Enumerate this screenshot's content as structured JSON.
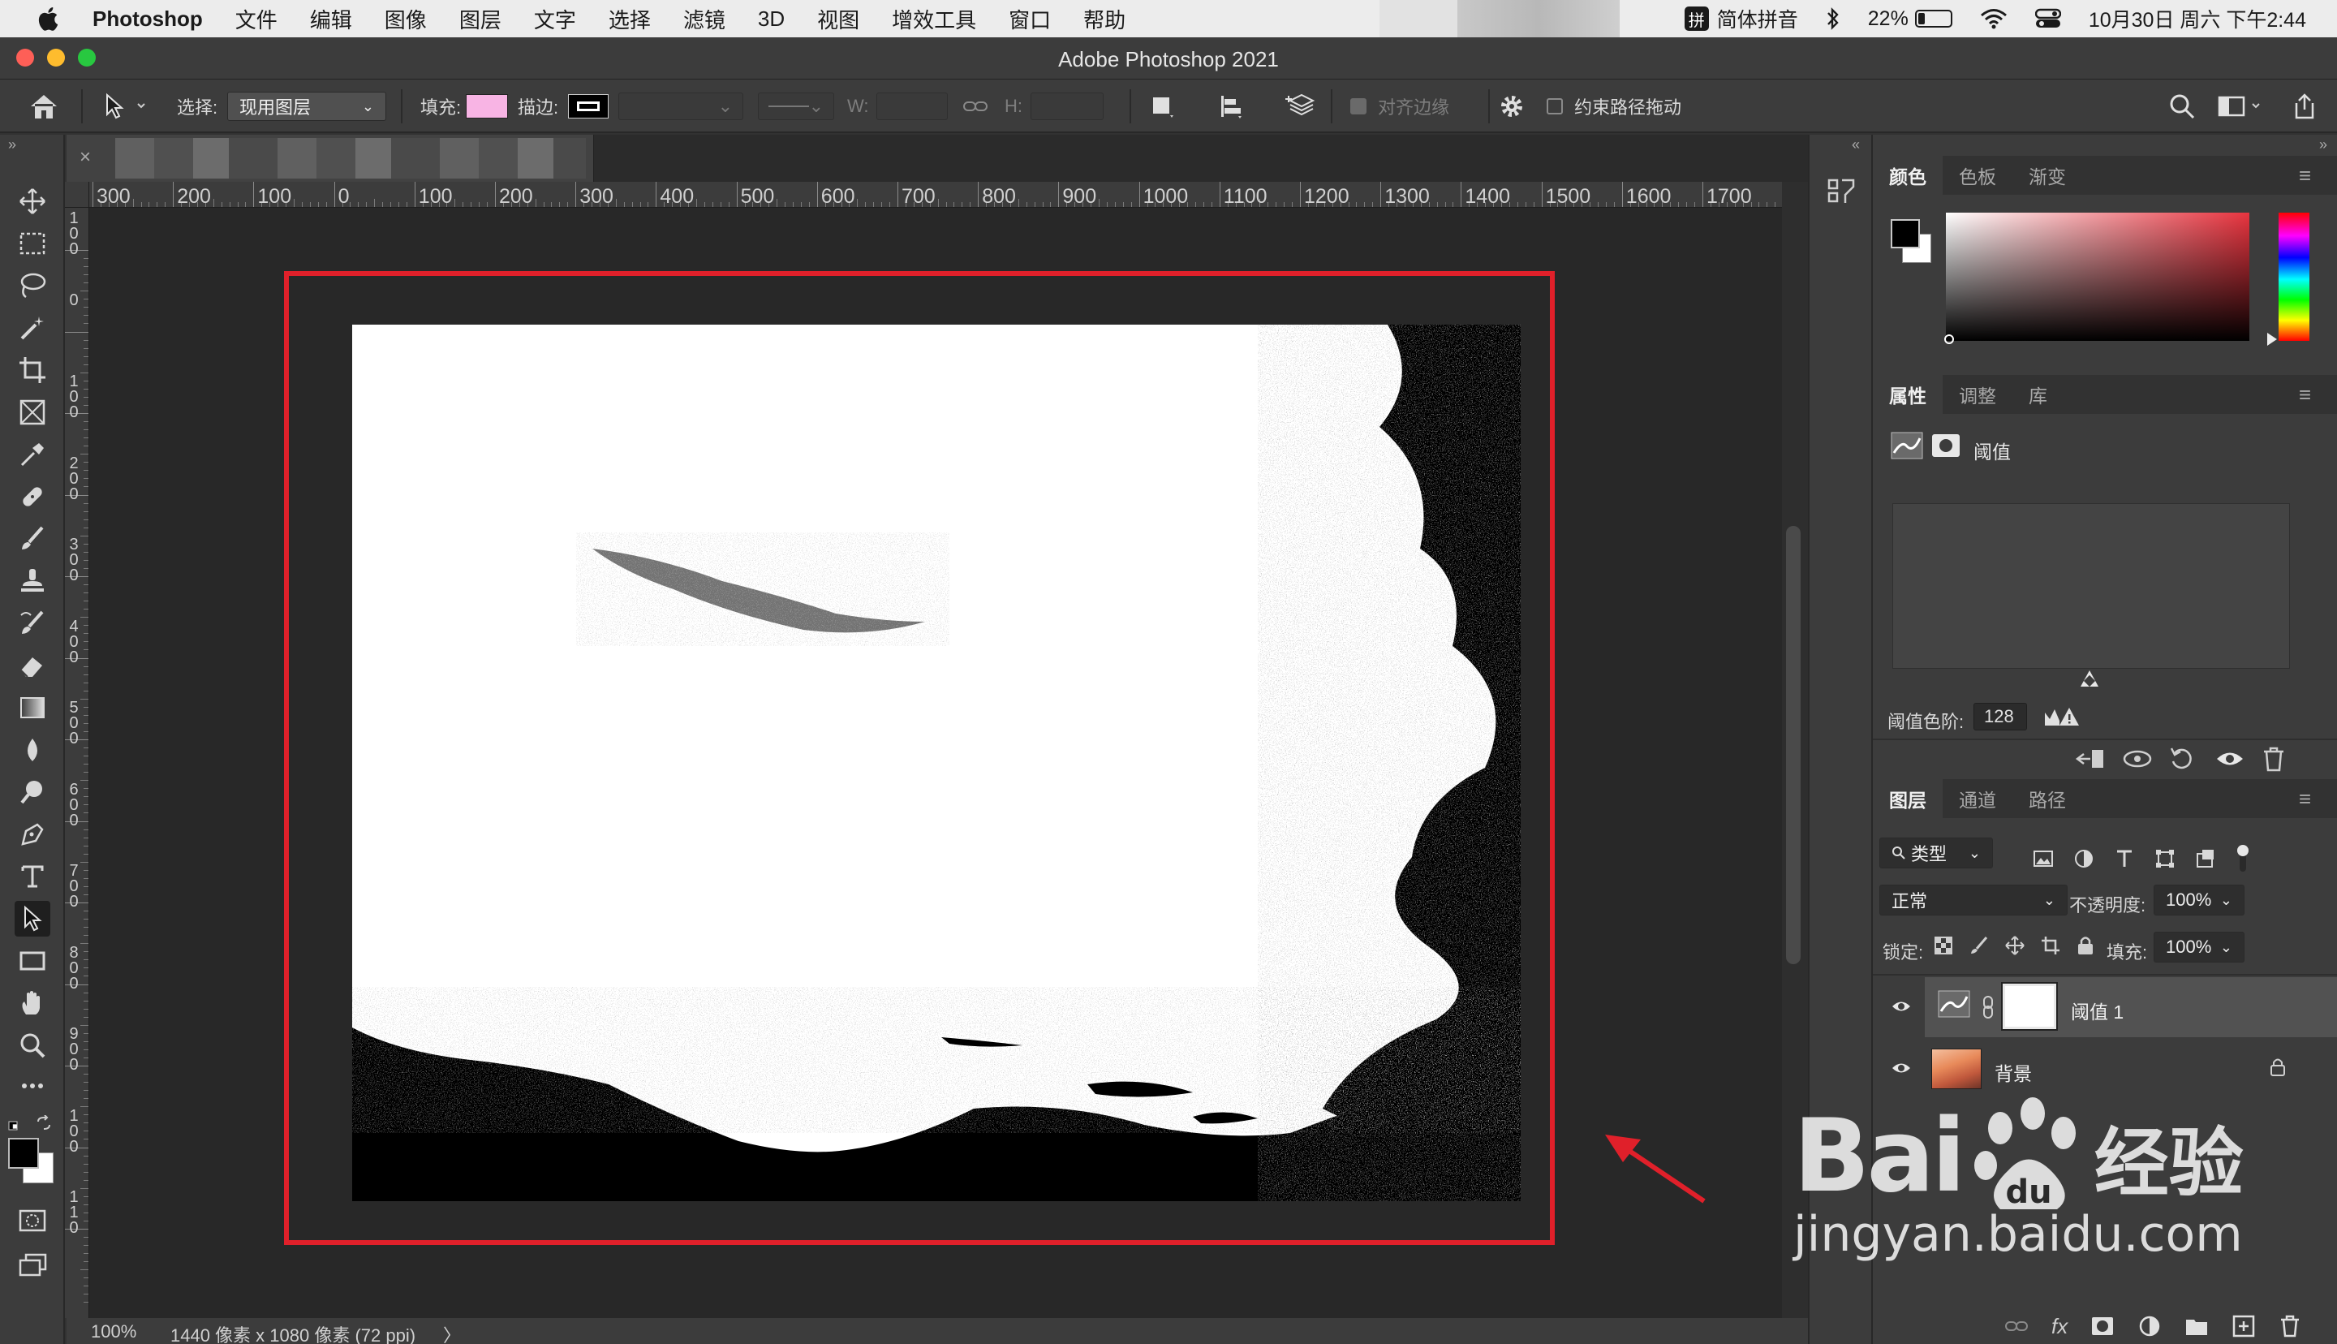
{
  "menubar": {
    "app_name": "Photoshop",
    "menus": [
      "文件",
      "编辑",
      "图像",
      "图层",
      "文字",
      "选择",
      "滤镜",
      "3D",
      "视图",
      "增效工具",
      "窗口",
      "帮助"
    ],
    "ime_icon": "拼",
    "ime_label": "简体拼音",
    "battery": "22%",
    "battery_level": 0.22,
    "datetime": "10月30日 周六 下午2:44"
  },
  "window": {
    "title": "Adobe Photoshop 2021"
  },
  "options": {
    "select_label": "选择:",
    "select_value": "现用图层",
    "fill_label": "填充:",
    "fill_color": "#f8b4e4",
    "stroke_label": "描边:",
    "w_label": "W:",
    "h_label": "H:",
    "align_edges": "对齐边缘",
    "constrain_path": "约束路径拖动"
  },
  "ruler": {
    "h_labels": [
      "300",
      "200",
      "100",
      "0",
      "100",
      "200",
      "300",
      "400",
      "500",
      "600",
      "700",
      "800",
      "900",
      "1000",
      "1100",
      "1200",
      "1300",
      "1400",
      "1500",
      "1600",
      "1700"
    ],
    "v_labels": [
      "1\n0\n0",
      "0",
      "1\n0\n0",
      "2\n0\n0",
      "3\n0\n0",
      "4\n0\n0",
      "5\n0\n0",
      "6\n0\n0",
      "7\n0\n0",
      "8\n0\n0",
      "9\n0\n0",
      "1\n0\n0",
      "1\n1\n0"
    ]
  },
  "status": {
    "zoom": "100%",
    "doc_info": "1440 像素 x 1080 像素 (72 ppi)",
    "arrow": "〉"
  },
  "color_panel": {
    "tabs": [
      "颜色",
      "色板",
      "渐变"
    ],
    "foreground": "#000000",
    "background": "#ffffff"
  },
  "properties_panel": {
    "tabs": [
      "属性",
      "调整",
      "库"
    ],
    "adjustment_name": "阈值",
    "level_label": "阈值色阶:",
    "level_value": "128"
  },
  "layers_panel": {
    "tabs": [
      "图层",
      "通道",
      "路径"
    ],
    "filter_kind": "类型",
    "blend_mode": "正常",
    "opacity_label": "不透明度:",
    "opacity_value": "100%",
    "lock_label": "锁定:",
    "fill_label": "填充:",
    "fill_value": "100%",
    "layers": [
      {
        "name": "阈值 1"
      },
      {
        "name": "背景"
      }
    ],
    "footer_fx": "fx"
  },
  "watermark": {
    "brand": "Bai",
    "brand2": "经验",
    "url": "jingyan.baidu.com"
  }
}
